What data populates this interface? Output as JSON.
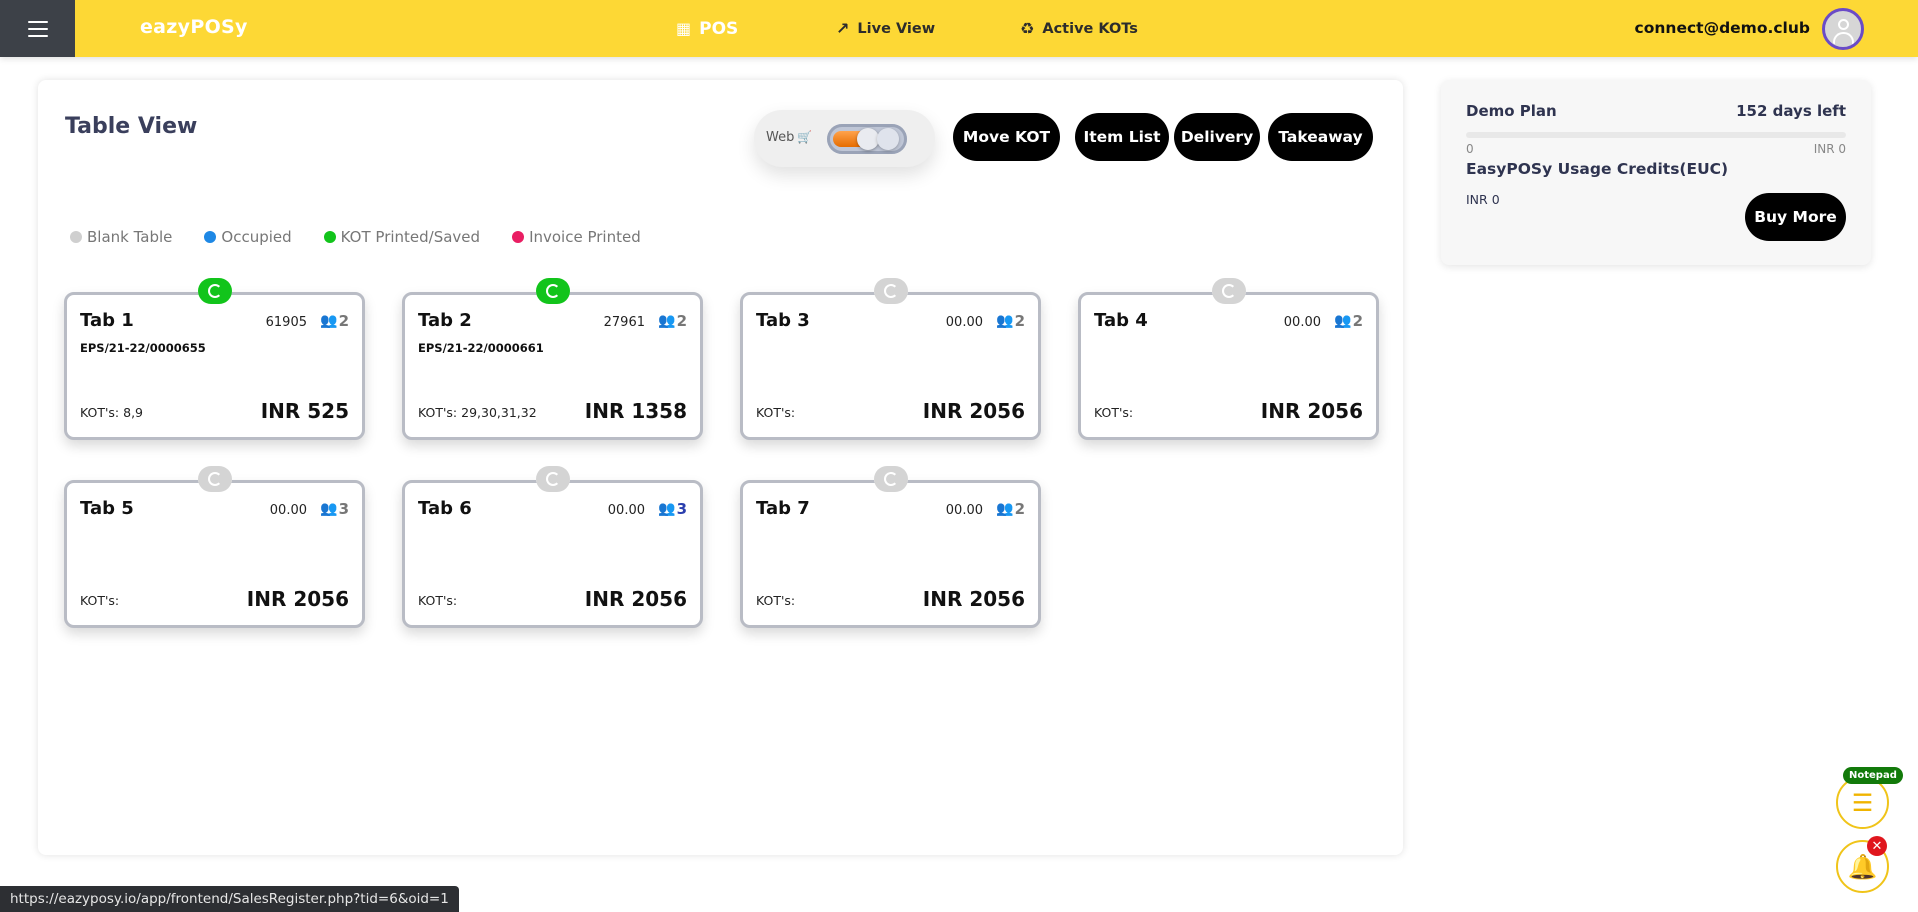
{
  "header": {
    "logo": "eazyPOSy",
    "nav": [
      {
        "label": "POS",
        "icon": "cash-register-icon"
      },
      {
        "label": "Live View",
        "icon": "trend-up-icon"
      },
      {
        "label": "Active KOTs",
        "icon": "kitchen-icon"
      }
    ],
    "user_email": "connect@demo.club"
  },
  "main": {
    "title": "Table View",
    "web_toggle_label": "Web",
    "web_toggle_on": true,
    "buttons": {
      "move_kot": "Move KOT",
      "item_list": "Item List",
      "delivery": "Delivery",
      "takeaway": "Takeaway"
    },
    "legend": [
      {
        "label": "Blank Table",
        "color": "#cfcfcf"
      },
      {
        "label": "Occupied",
        "color": "#1e88e5"
      },
      {
        "label": "KOT Printed/Saved",
        "color": "#12c41b"
      },
      {
        "label": "Invoice Printed",
        "color": "#e91e63"
      }
    ],
    "tables": [
      {
        "name": "Tab 1",
        "amount": "61905",
        "people": "2",
        "invoice": "EPS/21-22/0000655",
        "kots": "KOT's: 8,9",
        "total": "INR 525",
        "status": "active"
      },
      {
        "name": "Tab 2",
        "amount": "27961",
        "people": "2",
        "invoice": "EPS/21-22/0000661",
        "kots": "KOT's: 29,30,31,32",
        "total": "INR 1358",
        "status": "active"
      },
      {
        "name": "Tab 3",
        "amount": "00.00",
        "people": "2",
        "invoice": "",
        "kots": "KOT's:",
        "total": "INR 2056",
        "status": "blank"
      },
      {
        "name": "Tab 4",
        "amount": "00.00",
        "people": "2",
        "invoice": "",
        "kots": "KOT's:",
        "total": "INR 2056",
        "status": "blank"
      },
      {
        "name": "Tab 5",
        "amount": "00.00",
        "people": "3",
        "invoice": "",
        "kots": "KOT's:",
        "total": "INR 2056",
        "status": "blank"
      },
      {
        "name": "Tab 6",
        "amount": "00.00",
        "people": "3",
        "invoice": "",
        "kots": "KOT's:",
        "total": "INR 2056",
        "status": "blank",
        "people_color": "#2b3fae"
      },
      {
        "name": "Tab 7",
        "amount": "00.00",
        "people": "2",
        "invoice": "",
        "kots": "KOT's:",
        "total": "INR 2056",
        "status": "blank"
      }
    ]
  },
  "plan": {
    "name": "Demo Plan",
    "days_left": "152 days left",
    "bar_start": "0",
    "bar_end": "INR 0",
    "usage_progress": 0,
    "euc_title": "EasyPOSy Usage Credits(EUC)",
    "credits": "INR 0",
    "buy_label": "Buy More"
  },
  "floating": {
    "notepad_label": "Notepad"
  },
  "statusbar": {
    "url": "https://eazyposy.io/app/frontend/SalesRegister.php?tid=6&oid=1"
  },
  "colors": {
    "topbar": "#fdd835",
    "kot_green": "#12c41b",
    "accent_dark": "#000000"
  }
}
